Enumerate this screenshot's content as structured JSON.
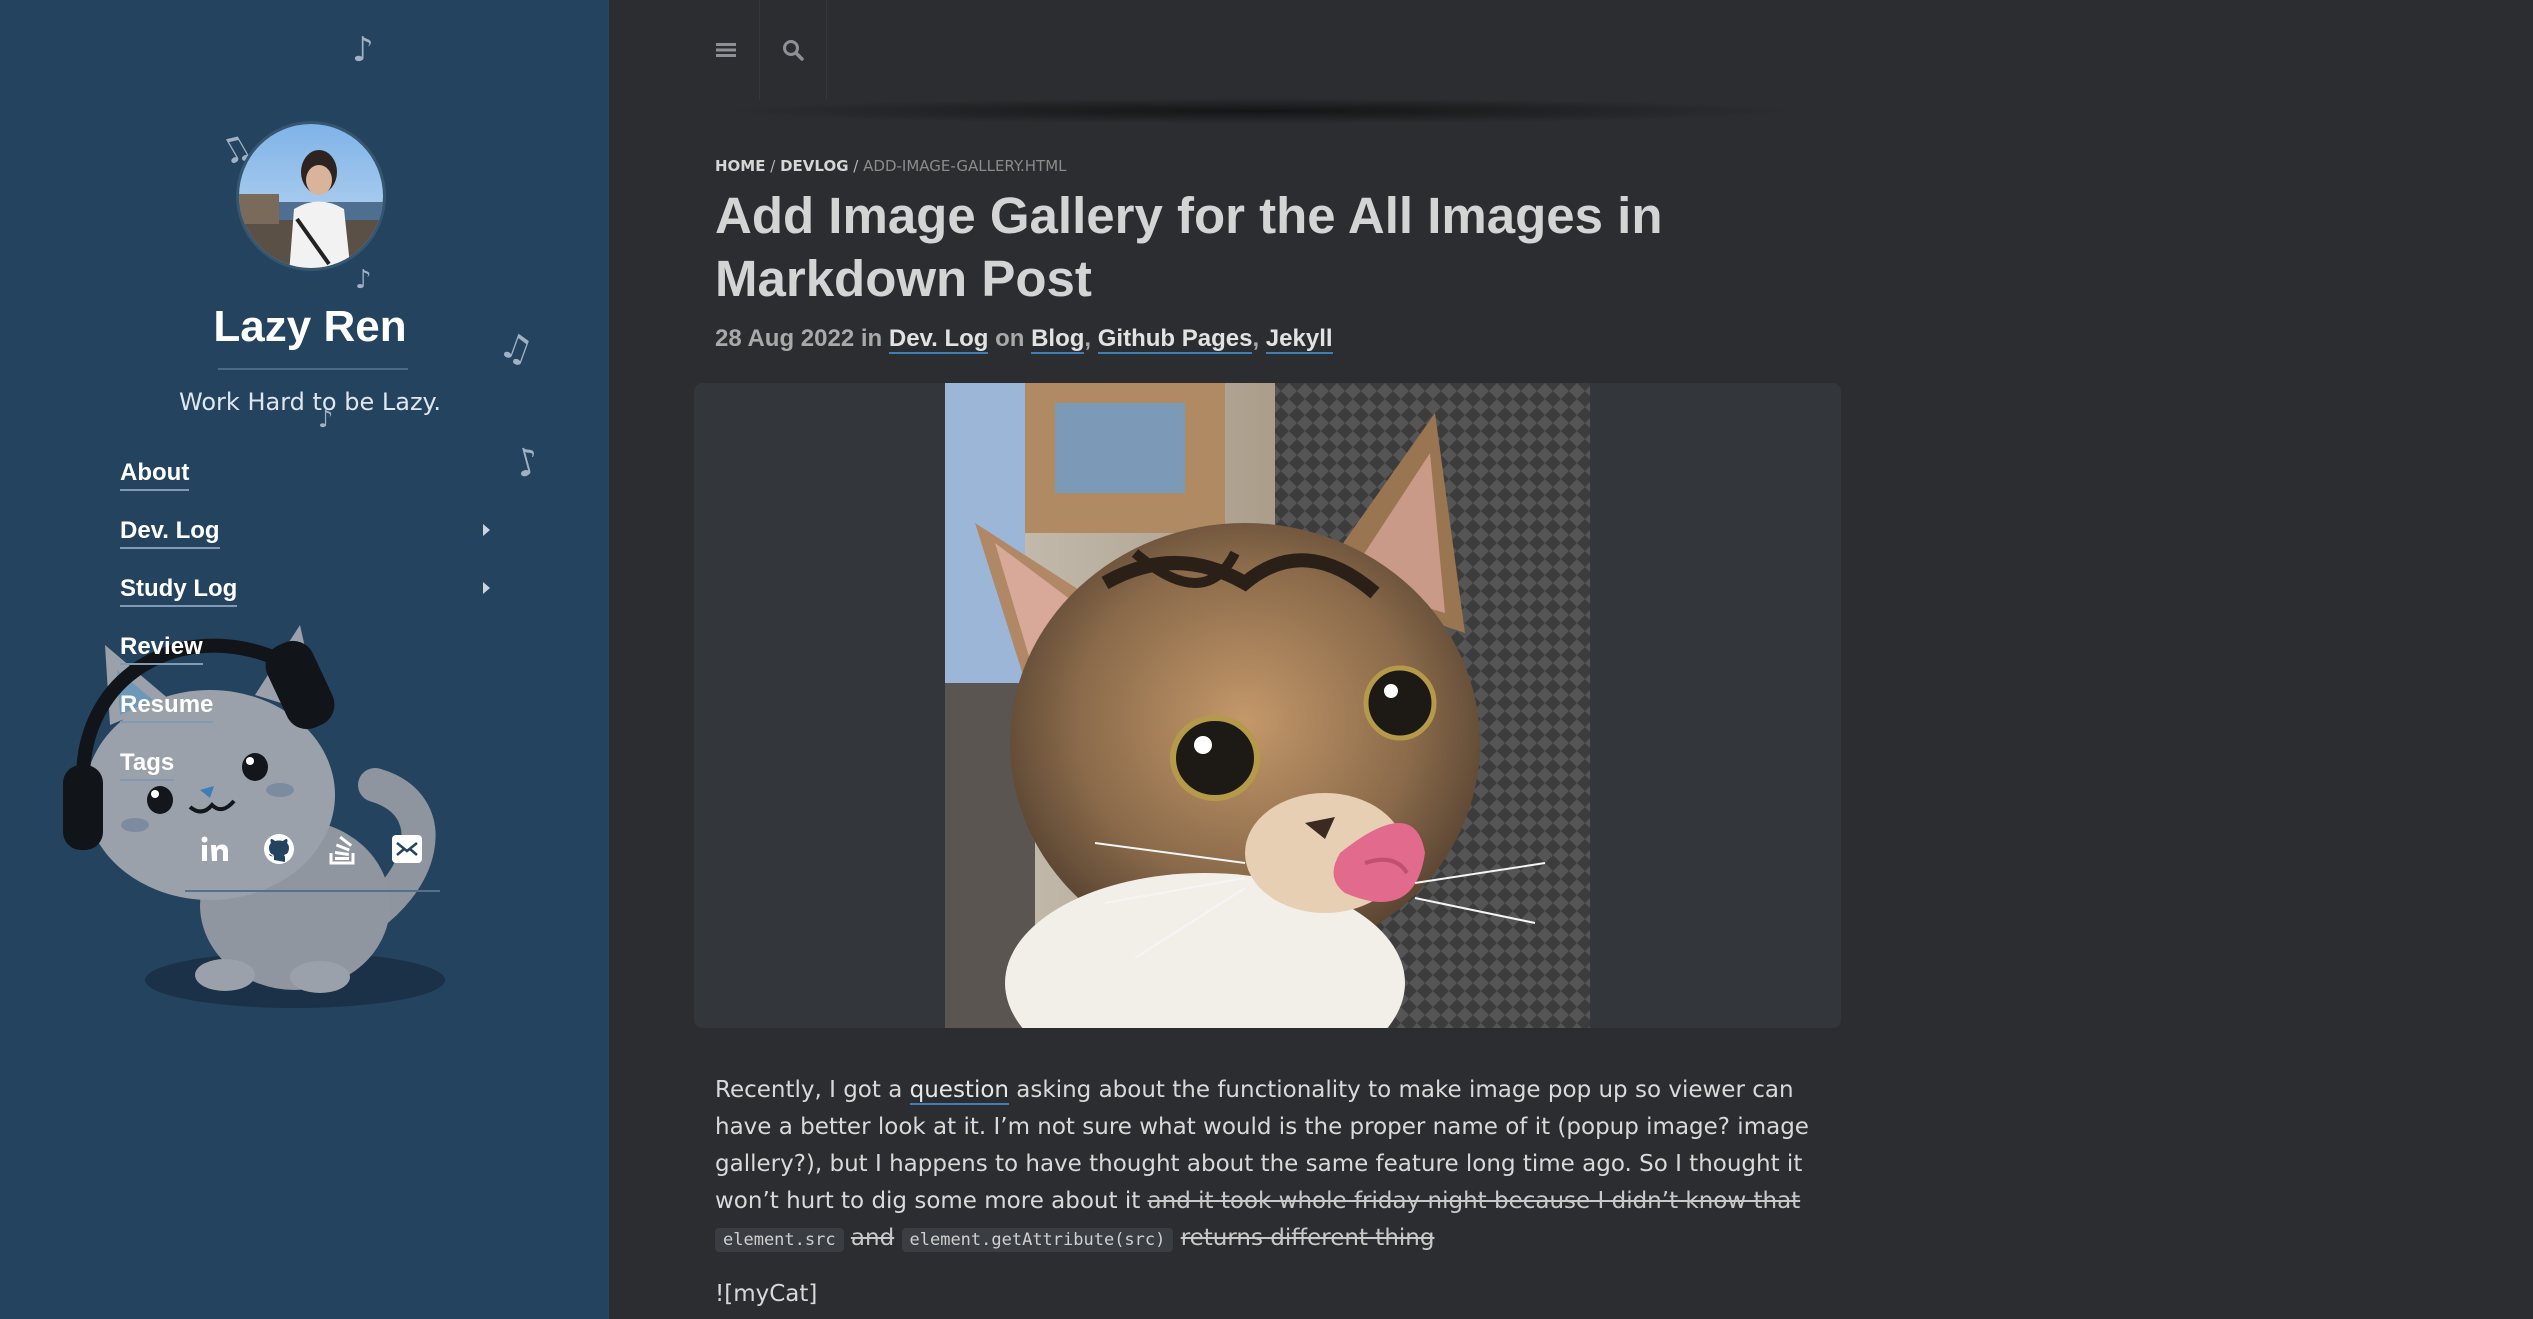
{
  "sidebar": {
    "site_title": "Lazy Ren",
    "tagline": "Work Hard to be Lazy.",
    "nav": [
      {
        "label": "About",
        "has_submenu": false
      },
      {
        "label": "Dev. Log",
        "has_submenu": true
      },
      {
        "label": "Study Log",
        "has_submenu": true
      },
      {
        "label": "Review",
        "has_submenu": false
      },
      {
        "label": "Resume",
        "has_submenu": false
      },
      {
        "label": "Tags",
        "has_submenu": false
      }
    ],
    "social_icons": [
      "linkedin-icon",
      "github-icon",
      "stackoverflow-icon",
      "email-icon"
    ],
    "background_color": "#24435f"
  },
  "topbar": {
    "menu_icon": "hamburger-menu-icon",
    "search_icon": "search-icon"
  },
  "breadcrumb": {
    "home": "HOME",
    "sep1": "/",
    "section": "DEVLOG",
    "sep2": "/",
    "current": "ADD-IMAGE-GALLERY.HTML"
  },
  "post": {
    "title": "Add Image Gallery for the All Images in Markdown Post",
    "date": "28 Aug 2022",
    "in_word": "in",
    "category": "Dev. Log",
    "on_word": "on",
    "tags": [
      "Blog",
      "Github Pages",
      "Jekyll"
    ],
    "tag_separator": ",",
    "paragraph": {
      "before_link": "Recently, I got a ",
      "link": "question",
      "after_link": " asking about the functionality to make image pop up so viewer can have a better look at it. I’m not sure what would is the proper name of it (popup image? image gallery?), but I happens to have thought about the same feature long time ago. So I thought it won’t hurt to dig some more about it ",
      "strike_1": "and it took whole friday night because I didn’t know that",
      "code_1": "element.src",
      "strike_2": "and",
      "code_2": "element.getAttribute(src)",
      "strike_3": "returns different thing"
    },
    "markdown_line": "![myCat]"
  },
  "colors": {
    "page_bg": "#2b2d30",
    "link_underline": "#3f7fb8"
  }
}
